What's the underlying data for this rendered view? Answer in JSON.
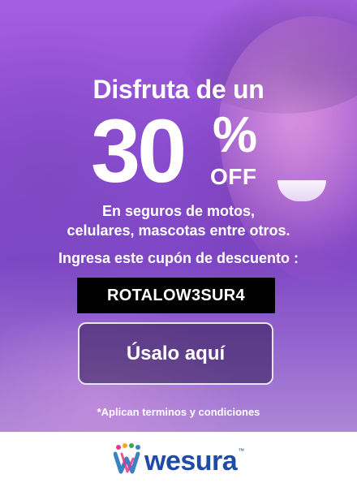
{
  "promo": {
    "headline": "Disfruta de un",
    "discount_number": "30",
    "discount_symbol": "%",
    "discount_suffix": "OFF",
    "description_line1": "En seguros de motos,",
    "description_line2": "celulares, mascotas entre otros.",
    "coupon_label": "Ingresa este cupón de descuento :",
    "coupon_code": "ROTALOW3SUR4",
    "cta_label": "Úsalo aquí",
    "terms": "*Aplican terminos y condiciones"
  },
  "brand": {
    "name": "wesura",
    "trademark": "™",
    "logo_icon": "wesura-logo",
    "logo_color": "#1f4aa8",
    "dot_colors": [
      "#e9378b",
      "#f5a623",
      "#3aa84b",
      "#3b82c4"
    ]
  },
  "colors": {
    "background_purple": "#8a4cd0",
    "coupon_bg": "#000000",
    "text": "#ffffff"
  }
}
